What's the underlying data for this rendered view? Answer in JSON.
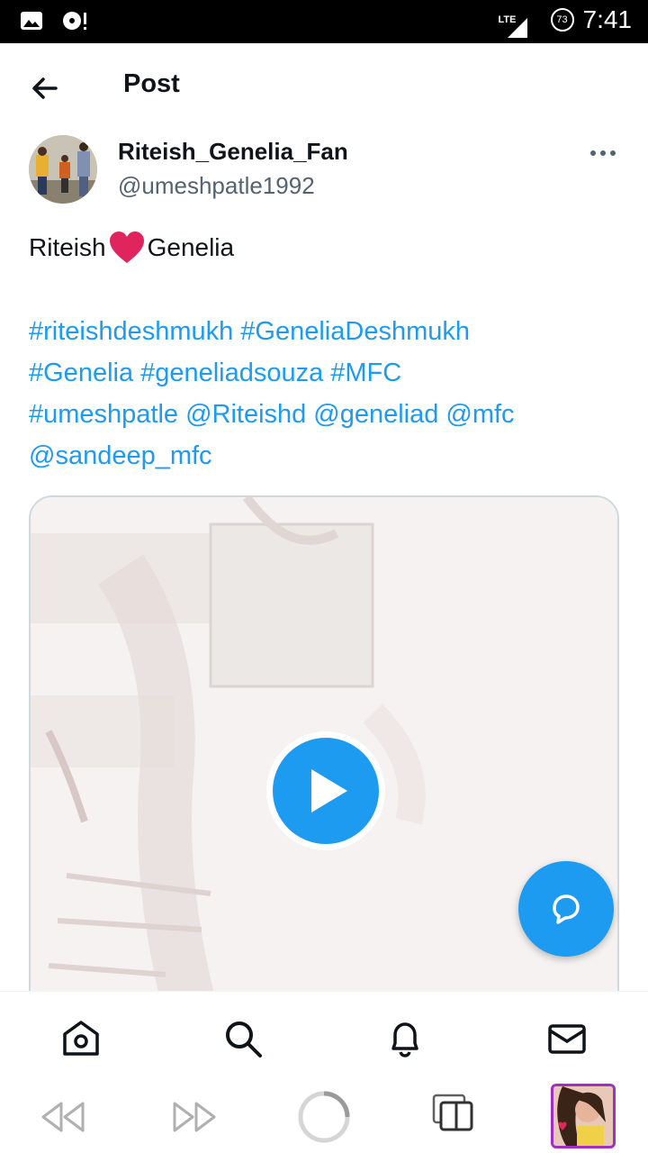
{
  "status_bar": {
    "time": "7:41",
    "network": "LTE",
    "battery": "73"
  },
  "header": {
    "title": "Post"
  },
  "post": {
    "author_name": "Riteish_Genelia_Fan",
    "author_handle": "@umeshpatle1992",
    "text_before": "Riteish",
    "text_after": "Genelia",
    "tags": [
      "#riteishdeshmukh",
      "#GeneliaDeshmukh",
      "#Genelia",
      "#geneliadsouza",
      "#MFC",
      "#umeshpatle",
      "@Riteishd",
      "@geneliad",
      "@mfc",
      "@sandeep_mfc"
    ]
  },
  "colors": {
    "accent": "#1d9bf0",
    "text": "#0f1419",
    "secondary": "#536471",
    "heart": "#e0245e"
  },
  "icons": {
    "back": "arrow-left-icon",
    "more": "more-horizontal-icon",
    "play": "play-icon",
    "reply": "reply-bubble-icon",
    "home": "home-icon",
    "search": "search-icon",
    "notifications": "bell-icon",
    "messages": "mail-icon"
  }
}
